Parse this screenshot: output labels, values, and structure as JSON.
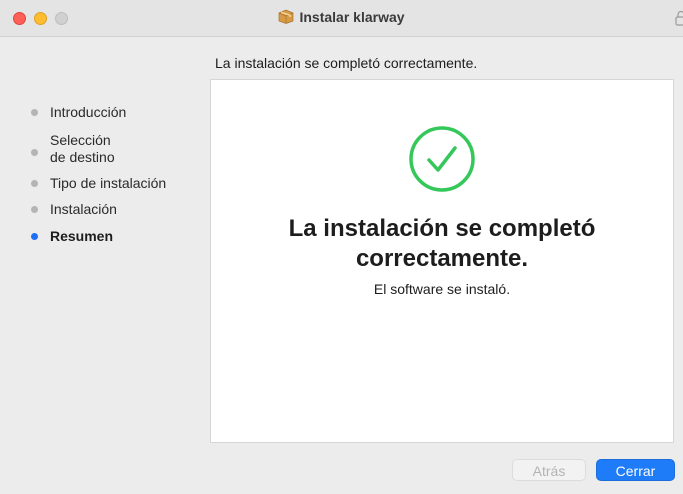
{
  "window": {
    "title": "Instalar klarway",
    "title_icon": "package-icon",
    "lock_icon": "lock-icon"
  },
  "heading": "La instalación se completó correctamente.",
  "sidebar": {
    "steps": [
      {
        "label": "Introducción",
        "active": false
      },
      {
        "label": "Selección de destino",
        "active": false
      },
      {
        "label": "Tipo de instalación",
        "active": false
      },
      {
        "label": "Instalación",
        "active": false
      },
      {
        "label": "Resumen",
        "active": true
      }
    ]
  },
  "content": {
    "title_line1": "La instalación se completó",
    "title_line2": "correctamente.",
    "subtitle": "El software se instaló.",
    "status_icon": "checkmark-circle-icon"
  },
  "buttons": {
    "back_label": "Atrás",
    "close_label": "Cerrar"
  },
  "colors": {
    "accent": "#1f7cf8",
    "success": "#34c759",
    "active_step": "#1f6ff6"
  }
}
